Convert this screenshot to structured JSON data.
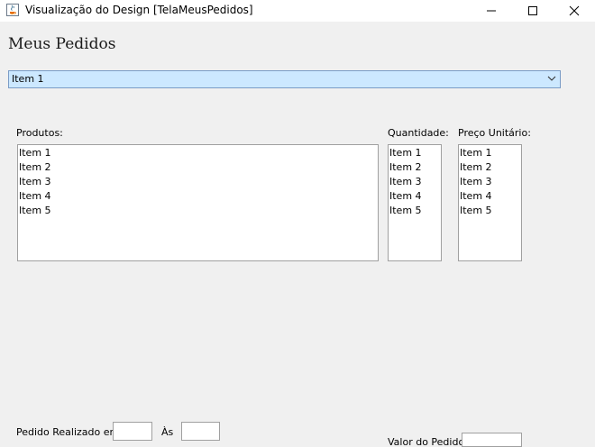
{
  "window": {
    "title": "Visualização do Design [TelaMeusPedidos]",
    "icon": "java-cup-icon"
  },
  "heading": "Meus Pedidos",
  "combo": {
    "selected": "Item 1"
  },
  "labels": {
    "produtos": "Produtos:",
    "quantidade": "Quantidade:",
    "preco": "Preço Unitário:",
    "pedido_realizado": "Pedido Realizado em:",
    "as": "Às",
    "valor_pedido": "Valor do Pedido:"
  },
  "lists": {
    "produtos": [
      "Item 1",
      "Item 2",
      "Item 3",
      "Item 4",
      "Item 5"
    ],
    "quantidade": [
      "Item 1",
      "Item 2",
      "Item 3",
      "Item 4",
      "Item 5"
    ],
    "preco": [
      "Item 1",
      "Item 2",
      "Item 3",
      "Item 4",
      "Item 5"
    ]
  },
  "fields": {
    "data": "",
    "hora": "",
    "valor": ""
  }
}
